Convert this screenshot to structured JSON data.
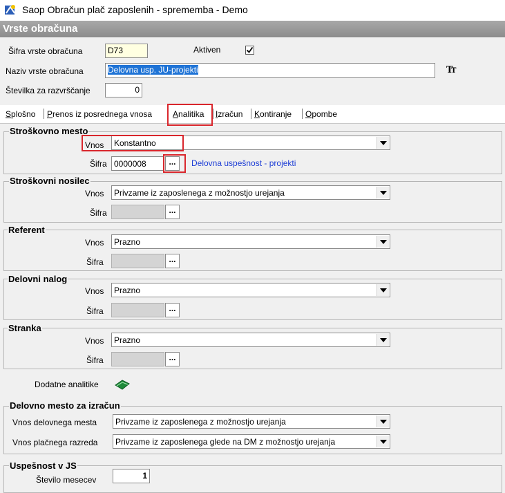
{
  "window": {
    "title": "Saop Obračun plač zaposlenih - sprememba - Demo",
    "icon": "app-icon"
  },
  "panel": {
    "title": "Vrste obračuna"
  },
  "header": {
    "code_label": "Šifra vrste obračuna",
    "code_value": "D73",
    "active_label": "Aktiven",
    "active_checked": true,
    "name_label": "Naziv vrste obračuna",
    "name_value": "Delovna usp. JU-projekti",
    "order_label": "Številka  za razvrščanje",
    "order_value": "0"
  },
  "tabs": [
    {
      "label": "Splošno",
      "active": false
    },
    {
      "label": "Prenos iz posrednega vnosa",
      "active": false
    },
    {
      "label": "Analitika",
      "active": true
    },
    {
      "label": "Izračun",
      "active": false
    },
    {
      "label": "Kontiranje",
      "active": false
    },
    {
      "label": "Opombe",
      "active": false
    }
  ],
  "groups": {
    "cost_center": {
      "title": "Stroškovno mesto",
      "vnos_label": "Vnos",
      "vnos_value": "Konstantno",
      "sifra_label": "Šifra",
      "sifra_value": "0000008",
      "sifra_desc": "Delovna uspešnost - projekti"
    },
    "cost_carrier": {
      "title": "Stroškovni nosilec",
      "vnos_label": "Vnos",
      "vnos_value": "Privzame iz zaposlenega z možnostjo urejanja",
      "sifra_label": "Šifra"
    },
    "referent": {
      "title": "Referent",
      "vnos_label": "Vnos",
      "vnos_value": "Prazno",
      "sifra_label": "Šifra"
    },
    "work_order": {
      "title": "Delovni nalog",
      "vnos_label": "Vnos",
      "vnos_value": "Prazno",
      "sifra_label": "Šifra"
    },
    "customer": {
      "title": "Stranka",
      "vnos_label": "Vnos",
      "vnos_value": "Prazno",
      "sifra_label": "Šifra"
    }
  },
  "extra_analytics": {
    "label": "Dodatne analitike",
    "icon": "book-icon"
  },
  "workplace": {
    "title": "Delovno mesto za izračun",
    "input_label": "Vnos delovnega mesta",
    "input_value": "Privzame iz zaposlenega z možnostjo urejanja",
    "grade_label": "Vnos plačnega razreda",
    "grade_value": "Privzame iz zaposlenega glede na DM z možnostjo urejanja"
  },
  "success": {
    "title": "Uspešnost v JS",
    "months_label": "Število mesecev",
    "months_value": "1"
  },
  "colors": {
    "highlight_red": "#d9262c",
    "link_blue": "#1f3fd6",
    "selection_blue": "#1e73d6"
  }
}
